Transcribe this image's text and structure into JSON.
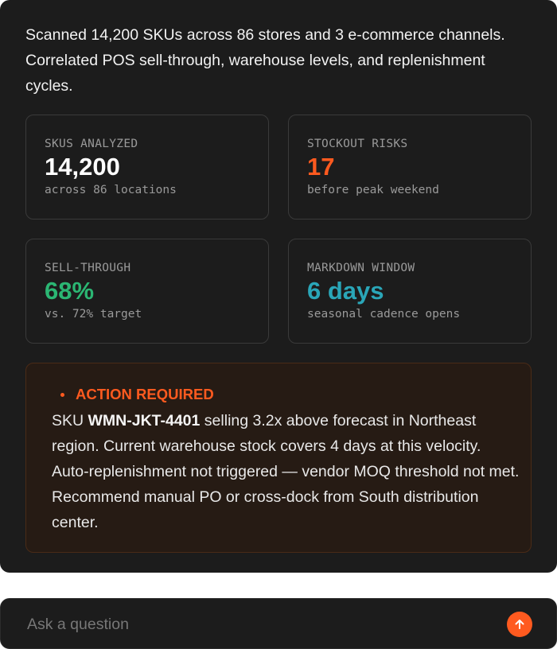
{
  "intro": {
    "line1": "Scanned 14,200 SKUs across 86 stores and 3 e-commerce channels.",
    "line2": "Correlated POS sell-through, warehouse levels, and replenishment cycles."
  },
  "metrics": [
    {
      "label": "SKUS ANALYZED",
      "value": "14,200",
      "sub": "across 86 locations",
      "color": "#ffffff"
    },
    {
      "label": "STOCKOUT RISKS",
      "value": "17",
      "sub": "before peak weekend",
      "color": "#ff5a1f"
    },
    {
      "label": "SELL-THROUGH",
      "value": "68%",
      "sub": "vs. 72% target",
      "color": "#2bb673"
    },
    {
      "label": "MARKDOWN WINDOW",
      "value": "6 days",
      "sub": "seasonal cadence opens",
      "color": "#2aa6b8"
    }
  ],
  "alert": {
    "heading": "ACTION REQUIRED",
    "pre": "SKU ",
    "sku": "WMN-JKT-4401",
    "post": " selling 3.2x above forecast in Northeast region. Current warehouse stock covers 4 days at this velocity. Auto-replenishment not triggered — vendor MOQ threshold not met. Recommend manual PO or cross-dock from South distribution center.",
    "accent": "#ff5a1f"
  },
  "ask": {
    "placeholder": "Ask a question",
    "send_icon": "arrow-up-icon"
  }
}
